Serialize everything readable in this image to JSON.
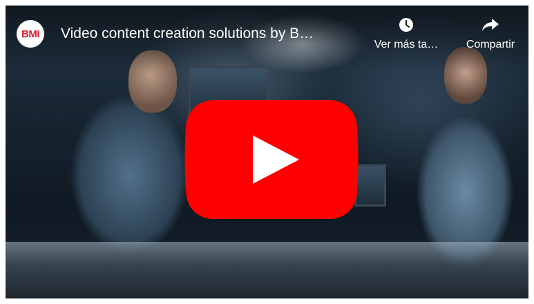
{
  "player": {
    "channel_logo_text": "BMI",
    "title": "Video content creation solutions by B…",
    "watch_later": {
      "label": "Ver más ta…",
      "icon": "clock-icon"
    },
    "share": {
      "label": "Compartir",
      "icon": "share-arrow-icon"
    },
    "play_button": {
      "icon": "youtube-play-icon",
      "color": "#ff0000"
    }
  },
  "colors": {
    "brand_red": "#d71f2b",
    "play_red": "#ff0000",
    "text": "#ffffff"
  }
}
